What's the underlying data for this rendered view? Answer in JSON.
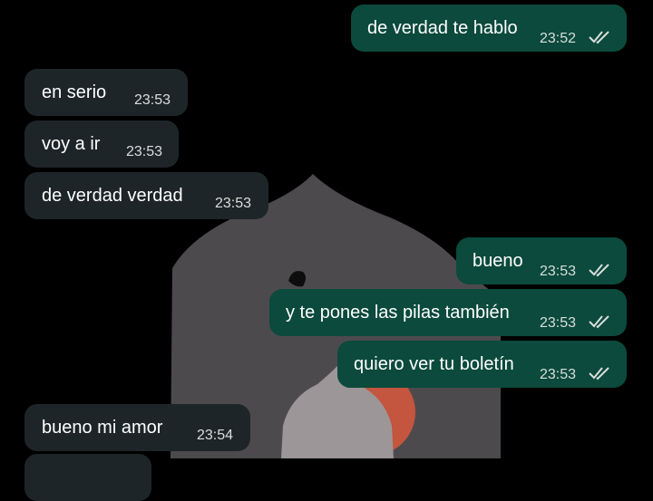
{
  "chat": {
    "messages": [
      {
        "direction": "out",
        "text": "de verdad te hablo",
        "time": "23:52",
        "status": "read-double-check-icon"
      },
      {
        "direction": "in",
        "text": "en serio",
        "time": "23:53"
      },
      {
        "direction": "in",
        "text": "voy a ir",
        "time": "23:53"
      },
      {
        "direction": "in",
        "text": "de verdad verdad",
        "time": "23:53"
      },
      {
        "direction": "out",
        "text": "bueno",
        "time": "23:53",
        "status": "read-double-check-icon"
      },
      {
        "direction": "out",
        "text": "y te pones las pilas también",
        "time": "23:53",
        "status": "read-double-check-icon"
      },
      {
        "direction": "out",
        "text": "quiero ver tu boletín",
        "time": "23:53",
        "status": "read-double-check-icon"
      },
      {
        "direction": "in",
        "text": "bueno mi amor",
        "time": "23:54"
      }
    ]
  },
  "colors": {
    "background": "#000000",
    "incoming_bubble": "#1e2528",
    "outgoing_bubble": "#0b4a3c",
    "text": "#ffffff",
    "timestamp": "#d9dedc",
    "wallpaper_arch": "#4d4a4d",
    "wallpaper_sun": "#c4553e"
  }
}
